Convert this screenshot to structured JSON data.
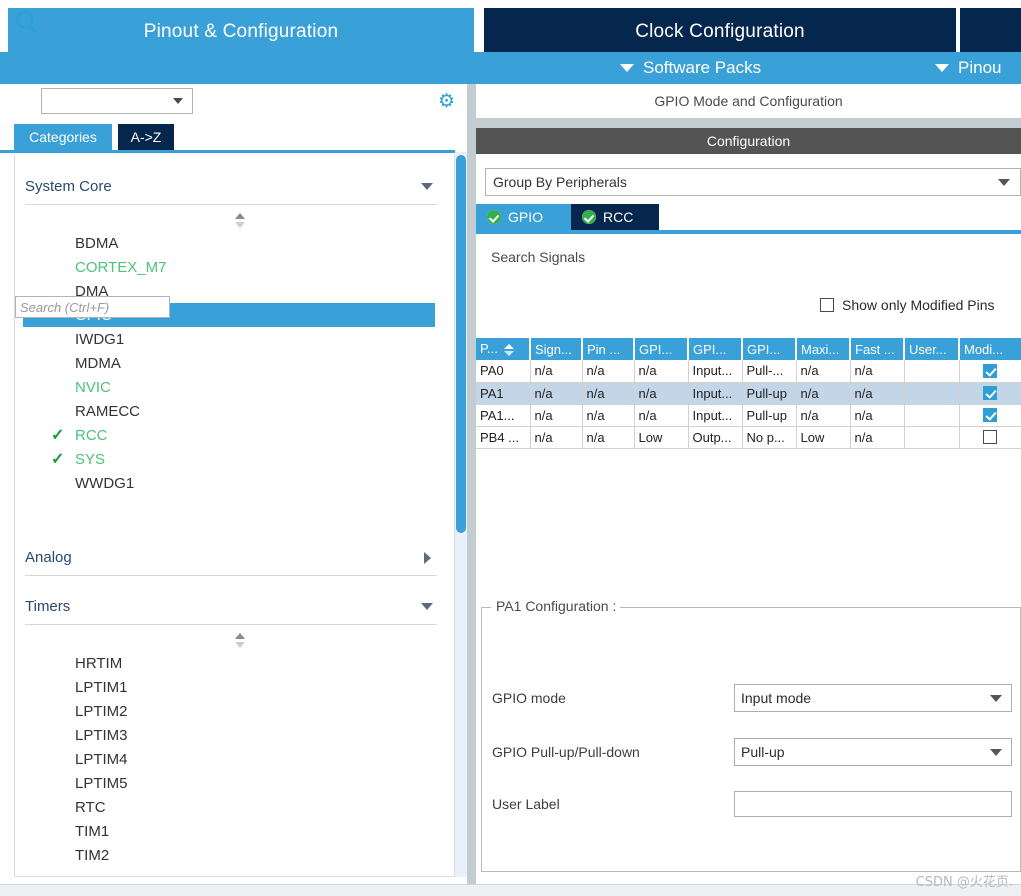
{
  "main_tabs": [
    {
      "label": "Pinout & Configuration",
      "state": "active"
    },
    {
      "label": "Clock Configuration",
      "state": "inactive"
    }
  ],
  "menu_items": [
    {
      "label": "Software Packs",
      "icon": "chevron-down-icon"
    },
    {
      "label": "Pinou",
      "icon": "chevron-down-icon"
    }
  ],
  "left_panel": {
    "search": {
      "value": "",
      "placeholder": "",
      "icon": "search-icon"
    },
    "settings_icon": "gear-icon",
    "sub_tabs": [
      {
        "label": "Categories",
        "state": "on"
      },
      {
        "label": "A->Z",
        "state": "off"
      }
    ],
    "groups": [
      {
        "title": "System Core",
        "expanded": true,
        "items": [
          {
            "label": "BDMA",
            "color": "default",
            "check": false
          },
          {
            "label": "CORTEX_M7",
            "color": "green",
            "check": false
          },
          {
            "label": "DMA",
            "color": "default",
            "check": false
          },
          {
            "label": "GPIO",
            "color": "default",
            "check": false,
            "selected": true
          },
          {
            "label": "IWDG1",
            "color": "default",
            "check": false
          },
          {
            "label": "MDMA",
            "color": "default",
            "check": false
          },
          {
            "label": "NVIC",
            "color": "green",
            "check": false
          },
          {
            "label": "RAMECC",
            "color": "default",
            "check": false
          },
          {
            "label": "RCC",
            "color": "green",
            "check": true
          },
          {
            "label": "SYS",
            "color": "green",
            "check": true
          },
          {
            "label": "WWDG1",
            "color": "default",
            "check": false
          }
        ]
      },
      {
        "title": "Analog",
        "expanded": false,
        "items": []
      },
      {
        "title": "Timers",
        "expanded": true,
        "items": [
          {
            "label": "HRTIM",
            "color": "default",
            "check": false
          },
          {
            "label": "LPTIM1",
            "color": "default",
            "check": false
          },
          {
            "label": "LPTIM2",
            "color": "default",
            "check": false
          },
          {
            "label": "LPTIM3",
            "color": "default",
            "check": false
          },
          {
            "label": "LPTIM4",
            "color": "default",
            "check": false
          },
          {
            "label": "LPTIM5",
            "color": "default",
            "check": false
          },
          {
            "label": "RTC",
            "color": "default",
            "check": false
          },
          {
            "label": "TIM1",
            "color": "default",
            "check": false
          },
          {
            "label": "TIM2",
            "color": "default",
            "check": false
          }
        ]
      }
    ]
  },
  "right_panel": {
    "mode_header": "GPIO Mode and Configuration",
    "configuration_bar": "Configuration",
    "group_by": {
      "value": "Group By Peripherals"
    },
    "peripheral_tabs": [
      {
        "label": "GPIO",
        "state": "on",
        "status_icon": "check-circle-icon"
      },
      {
        "label": "RCC",
        "state": "off",
        "status_icon": "check-circle-icon"
      }
    ],
    "search_signals_label": "Search Signals",
    "signal_search": {
      "value": "",
      "placeholder": "Search (Ctrl+F)"
    },
    "show_modified_pins": {
      "label": "Show only Modified Pins",
      "checked": false
    },
    "table": {
      "columns": [
        "P...",
        "Sign...",
        "Pin ...",
        "GPI...",
        "GPI...",
        "GPI...",
        "Maxi...",
        "Fast ...",
        "User...",
        "Modi..."
      ],
      "sort_column_index": 0,
      "rows": [
        {
          "selected": false,
          "cells": [
            "PA0",
            "n/a",
            "n/a",
            "n/a",
            "Input...",
            "Pull-...",
            "n/a",
            "n/a",
            ""
          ],
          "modified": true
        },
        {
          "selected": true,
          "cells": [
            "PA1",
            "n/a",
            "n/a",
            "n/a",
            "Input...",
            "Pull-up",
            "n/a",
            "n/a",
            ""
          ],
          "modified": true
        },
        {
          "selected": false,
          "cells": [
            "PA1...",
            "n/a",
            "n/a",
            "n/a",
            "Input...",
            "Pull-up",
            "n/a",
            "n/a",
            ""
          ],
          "modified": true
        },
        {
          "selected": false,
          "cells": [
            "PB4 ...",
            "n/a",
            "n/a",
            "Low",
            "Outp...",
            "No p...",
            "Low",
            "n/a",
            ""
          ],
          "modified": false
        }
      ]
    },
    "pin_config": {
      "title": "PA1 Configuration :",
      "fields": [
        {
          "label": "GPIO mode",
          "type": "select",
          "value": "Input mode"
        },
        {
          "label": "GPIO Pull-up/Pull-down",
          "type": "select",
          "value": "Pull-up"
        },
        {
          "label": "User Label",
          "type": "text",
          "value": ""
        }
      ]
    }
  },
  "watermark": "CSDN @火花页.",
  "colors": {
    "accent_light": "#3aa0d8",
    "accent_dark": "#06274d",
    "config_bar": "#545454",
    "row_selected": "#c3d6e8",
    "green": "#4cc27a",
    "check_green": "#1a9a3c"
  }
}
